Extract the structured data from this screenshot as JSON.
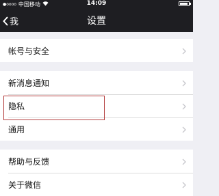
{
  "status_bar": {
    "signal_dots": "●oooo",
    "carrier": "中国移动",
    "wifi_icon": "wifi-icon",
    "time": "14:09",
    "battery_icon": "battery-icon"
  },
  "nav": {
    "back_label": "我",
    "title": "设置"
  },
  "groups": [
    {
      "items": [
        {
          "label": "帐号与安全"
        }
      ]
    },
    {
      "items": [
        {
          "label": "新消息通知"
        },
        {
          "label": "隐私"
        },
        {
          "label": "通用"
        }
      ]
    },
    {
      "items": [
        {
          "label": "帮助与反馈"
        },
        {
          "label": "关于微信"
        }
      ]
    }
  ],
  "colors": {
    "nav_bg": "#1e1e22",
    "page_bg": "#efeff4",
    "highlight_border": "#b23b3b",
    "chevron": "#c7c7cc"
  }
}
